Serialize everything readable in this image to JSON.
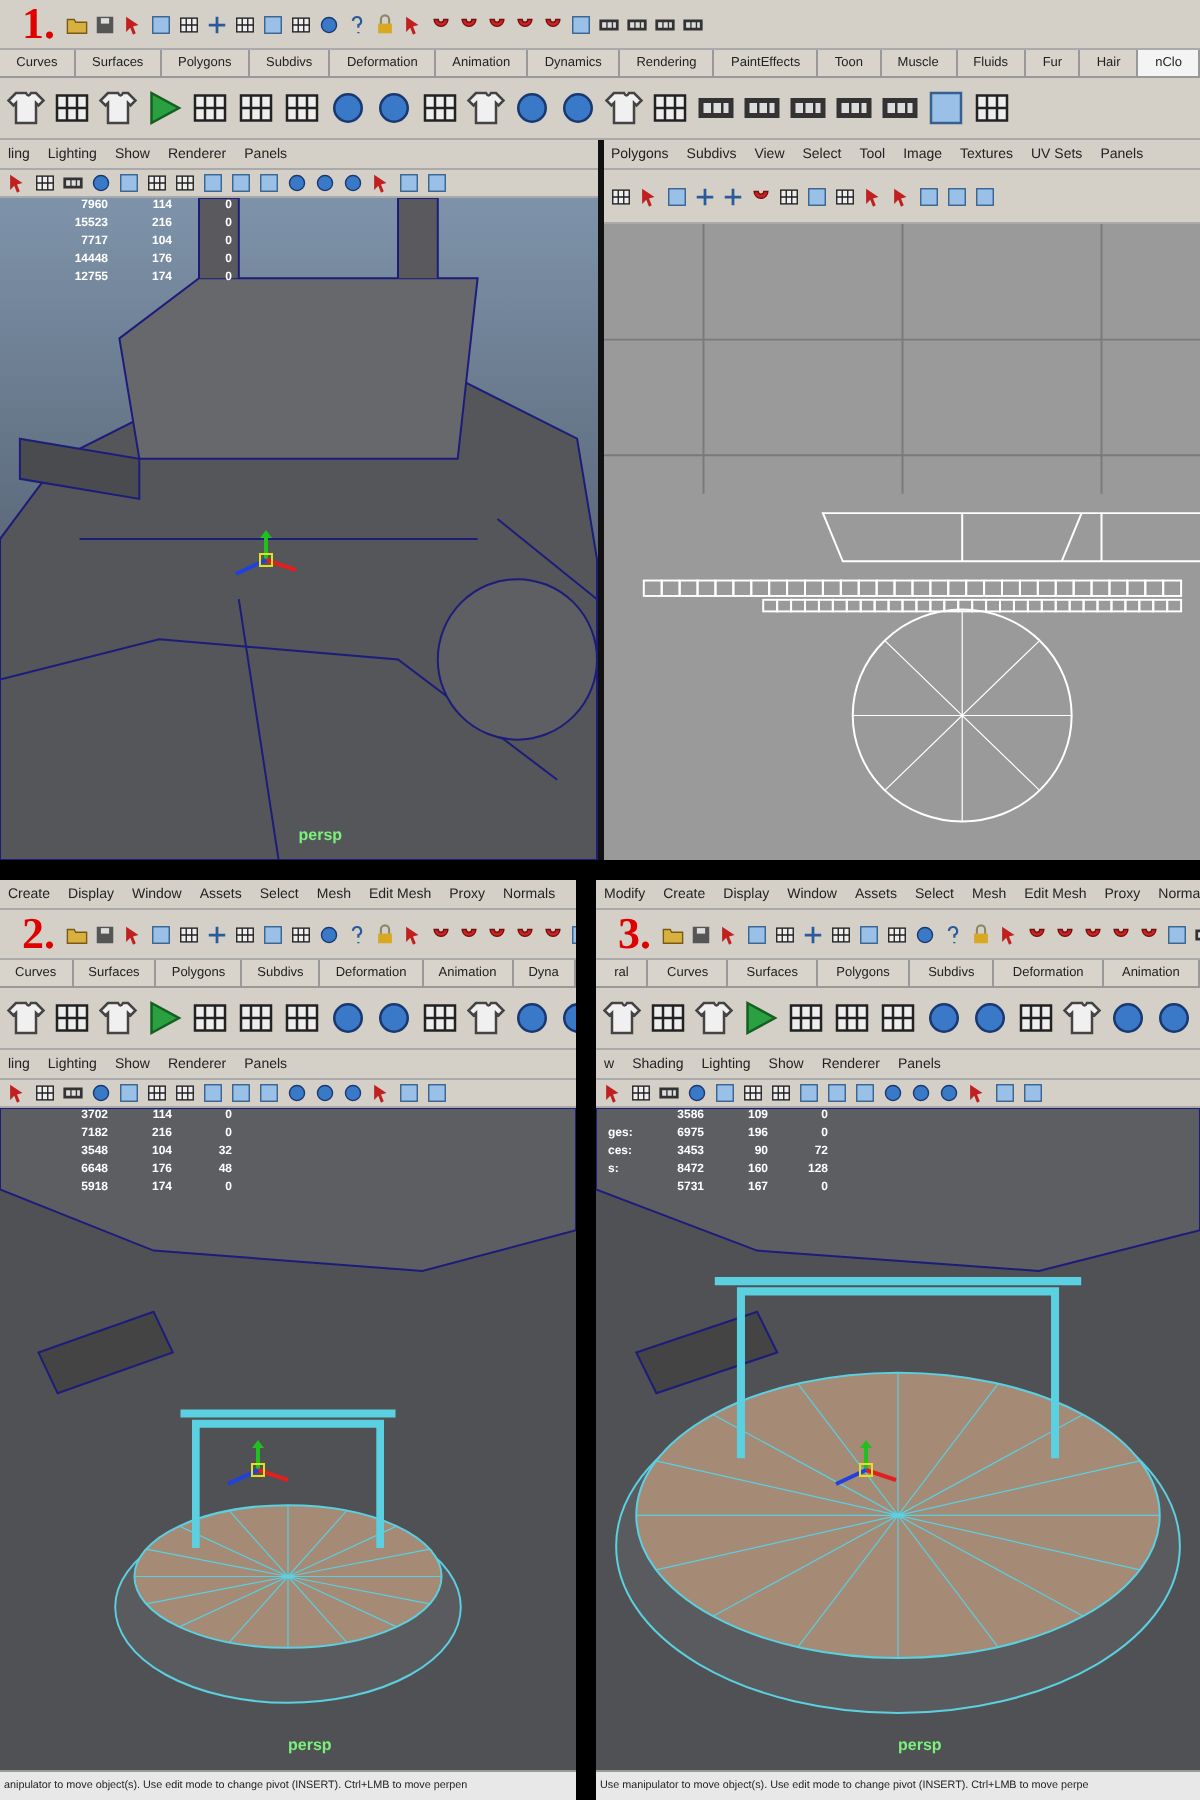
{
  "panels": [
    {
      "step": "1.",
      "shelf_tabs": [
        {
          "label": "Curves",
          "selected": false
        },
        {
          "label": "Surfaces",
          "selected": false
        },
        {
          "label": "Polygons",
          "selected": false
        },
        {
          "label": "Subdivs",
          "selected": false
        },
        {
          "label": "Deformation",
          "selected": false
        },
        {
          "label": "Animation",
          "selected": false
        },
        {
          "label": "Dynamics",
          "selected": false
        },
        {
          "label": "Rendering",
          "selected": false
        },
        {
          "label": "PaintEffects",
          "selected": false
        },
        {
          "label": "Toon",
          "selected": false
        },
        {
          "label": "Muscle",
          "selected": false
        },
        {
          "label": "Fluids",
          "selected": false
        },
        {
          "label": "Fur",
          "selected": false
        },
        {
          "label": "Hair",
          "selected": false
        },
        {
          "label": "nClo",
          "selected": true
        }
      ],
      "viewport": {
        "kind": "tank",
        "menu": [
          "ling",
          "Lighting",
          "Show",
          "Renderer",
          "Panels"
        ],
        "camera": "persp",
        "stats": [
          {
            "values": [
              "7960",
              "114",
              "0"
            ]
          },
          {
            "values": [
              "15523",
              "216",
              "0"
            ]
          },
          {
            "values": [
              "7717",
              "104",
              "0"
            ]
          },
          {
            "values": [
              "14448",
              "176",
              "0"
            ]
          },
          {
            "values": [
              "12755",
              "174",
              "0"
            ]
          }
        ]
      },
      "uv_editor": {
        "menu": [
          "Polygons",
          "Subdivs",
          "View",
          "Select",
          "Tool",
          "Image",
          "Textures",
          "UV Sets",
          "Panels"
        ]
      }
    },
    {
      "step": "2.",
      "menu": [
        "Create",
        "Display",
        "Window",
        "Assets",
        "Select",
        "Mesh",
        "Edit Mesh",
        "Proxy",
        "Normals"
      ],
      "shelf_tabs": [
        {
          "label": "Curves",
          "selected": false
        },
        {
          "label": "Surfaces",
          "selected": false
        },
        {
          "label": "Polygons",
          "selected": false
        },
        {
          "label": "Subdivs",
          "selected": false
        },
        {
          "label": "Deformation",
          "selected": false
        },
        {
          "label": "Animation",
          "selected": false
        },
        {
          "label": "Dyna",
          "selected": false
        }
      ],
      "viewport": {
        "kind": "disk-small",
        "menu": [
          "ling",
          "Lighting",
          "Show",
          "Renderer",
          "Panels"
        ],
        "camera": "persp",
        "stats": [
          {
            "values": [
              "3702",
              "114",
              "0"
            ]
          },
          {
            "values": [
              "7182",
              "216",
              "0"
            ]
          },
          {
            "values": [
              "3548",
              "104",
              "32"
            ]
          },
          {
            "values": [
              "6648",
              "176",
              "48"
            ]
          },
          {
            "values": [
              "5918",
              "174",
              "0"
            ]
          }
        ]
      },
      "status_line": "anipulator to move object(s). Use edit mode to change pivot (INSERT). Ctrl+LMB to move perpen"
    },
    {
      "step": "3.",
      "menu": [
        "Modify",
        "Create",
        "Display",
        "Window",
        "Assets",
        "Select",
        "Mesh",
        "Edit Mesh",
        "Proxy",
        "Norma"
      ],
      "shelf_tabs": [
        {
          "label": "ral",
          "selected": false
        },
        {
          "label": "Curves",
          "selected": false
        },
        {
          "label": "Surfaces",
          "selected": false
        },
        {
          "label": "Polygons",
          "selected": false
        },
        {
          "label": "Subdivs",
          "selected": false
        },
        {
          "label": "Deformation",
          "selected": false
        },
        {
          "label": "Animation",
          "selected": false
        }
      ],
      "viewport": {
        "kind": "disk-large",
        "menu": [
          "w",
          "Shading",
          "Lighting",
          "Show",
          "Renderer",
          "Panels"
        ],
        "camera": "persp",
        "stats": [
          {
            "values": [
              "3586",
              "109",
              "0"
            ]
          },
          {
            "label": "ges:",
            "values": [
              "6975",
              "196",
              "0"
            ]
          },
          {
            "label": "ces:",
            "values": [
              "3453",
              "90",
              "72"
            ]
          },
          {
            "label": "s:",
            "values": [
              "8472",
              "160",
              "128"
            ]
          },
          {
            "values": [
              "5731",
              "167",
              "0"
            ]
          }
        ]
      },
      "status_line": "Use manipulator to move object(s). Use edit mode to change pivot (INSERT). Ctrl+LMB to move perpe"
    }
  ]
}
